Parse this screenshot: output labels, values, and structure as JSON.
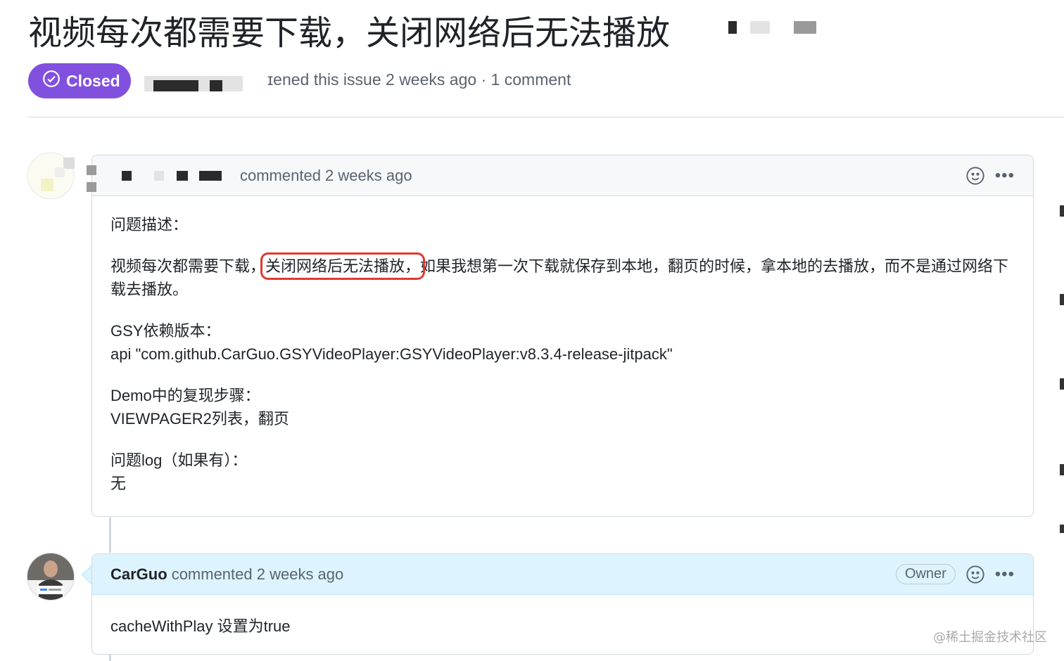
{
  "issue": {
    "title": "视频每次都需要下载，关闭网络后无法播放",
    "state_label": "Closed",
    "meta_text": "ɪened this issue 2 weeks ago · 1 comment"
  },
  "comments": [
    {
      "author": "",
      "timestamp": "commented 2 weeks ago",
      "body": {
        "p1": "问题描述：",
        "p2_before": "视频每次都需要下载，",
        "p2_highlight": "关闭网络后无法播放，",
        "p2_after": "如果我想第一次下载就保存到本地，翻页的时候，拿本地的去播放，而不是通过网络下载去播放。",
        "p3_label": "GSY依赖版本：",
        "p3_value": "api \"com.github.CarGuo.GSYVideoPlayer:GSYVideoPlayer:v8.3.4-release-jitpack\"",
        "p4_label": "Demo中的复现步骤：",
        "p4_value": "VIEWPAGER2列表，翻页",
        "p5_label": "问题log（如果有）：",
        "p5_value": "无"
      }
    },
    {
      "author": "CarGuo",
      "timestamp": "commented 2 weeks ago",
      "role_badge": "Owner",
      "body": {
        "p1": "cacheWithPlay 设置为true"
      }
    }
  ],
  "icons": {
    "closed": "check-circle-icon",
    "reaction": "smiley-icon",
    "more": "kebab-horizontal-icon"
  },
  "colors": {
    "closed_badge": "#8250df",
    "highlight_box": "#e03a2f",
    "owner_header": "#ddf4ff"
  },
  "watermark": "@稀土掘金技术社区"
}
